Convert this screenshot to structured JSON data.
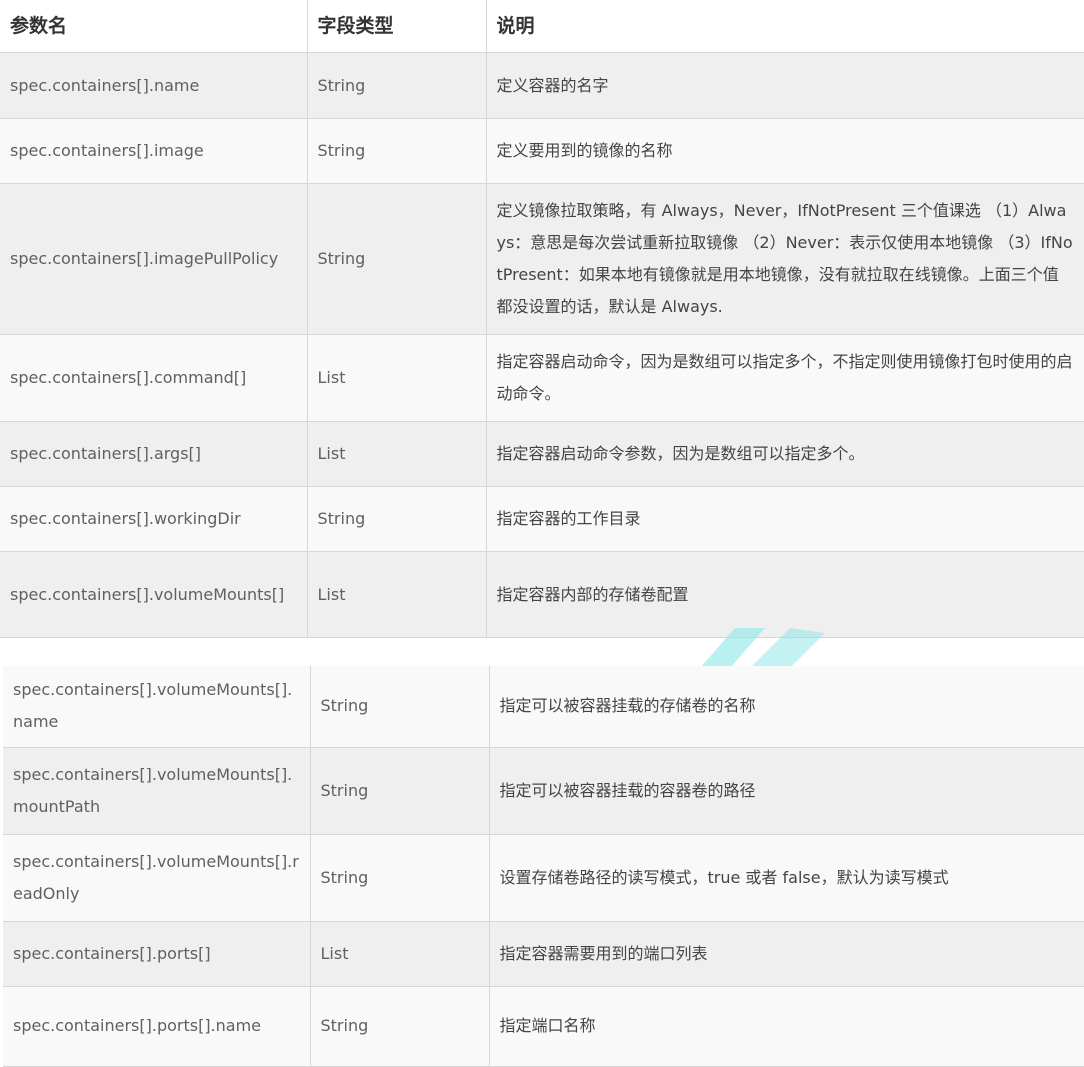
{
  "header": {
    "param": "参数名",
    "type": "字段类型",
    "desc": "说明"
  },
  "table1": [
    {
      "param": "spec.containers[].name",
      "type": "String",
      "desc": "定义容器的名字"
    },
    {
      "param": "spec.containers[].image",
      "type": "String",
      "desc": "定义要用到的镜像的名称"
    },
    {
      "param": "spec.containers[].imagePullPolicy",
      "type": "String",
      "desc": "定义镜像拉取策略，有 Always，Never，IfNotPresent 三个值课选 （1）Always：意思是每次尝试重新拉取镜像 （2）Never：表示仅使用本地镜像 （3）IfNotPresent：如果本地有镜像就是用本地镜像，没有就拉取在线镜像。上面三个值都没设置的话，默认是 Always."
    },
    {
      "param": "spec.containers[].command[]",
      "type": "List",
      "desc": "指定容器启动命令，因为是数组可以指定多个，不指定则使用镜像打包时使用的启动命令。"
    },
    {
      "param": "spec.containers[].args[]",
      "type": "List",
      "desc": "指定容器启动命令参数，因为是数组可以指定多个。"
    },
    {
      "param": "spec.containers[].workingDir",
      "type": "String",
      "desc": "指定容器的工作目录"
    },
    {
      "param": "spec.containers[].volumeMounts[]",
      "type": "List",
      "desc": "指定容器内部的存储卷配置"
    }
  ],
  "table2": [
    {
      "param": "spec.containers[].volumeMounts[].name",
      "type": "String",
      "desc": "指定可以被容器挂载的存储卷的名称"
    },
    {
      "param": "spec.containers[].volumeMounts[].mountPath",
      "type": "String",
      "desc": "指定可以被容器挂载的容器卷的路径"
    },
    {
      "param": "spec.containers[].volumeMounts[].readOnly",
      "type": "String",
      "desc": "设置存储卷路径的读写模式，true 或者 false，默认为读写模式"
    },
    {
      "param": "spec.containers[].ports[]",
      "type": "List",
      "desc": "指定容器需要用到的端口列表"
    },
    {
      "param": "spec.containers[].ports[].name",
      "type": "String",
      "desc": "指定端口名称"
    }
  ],
  "colors": {
    "row_dark": "#efefef",
    "row_light": "#f9f9f9",
    "border": "#d6d6d6",
    "watermark": "#7fe0e0"
  }
}
